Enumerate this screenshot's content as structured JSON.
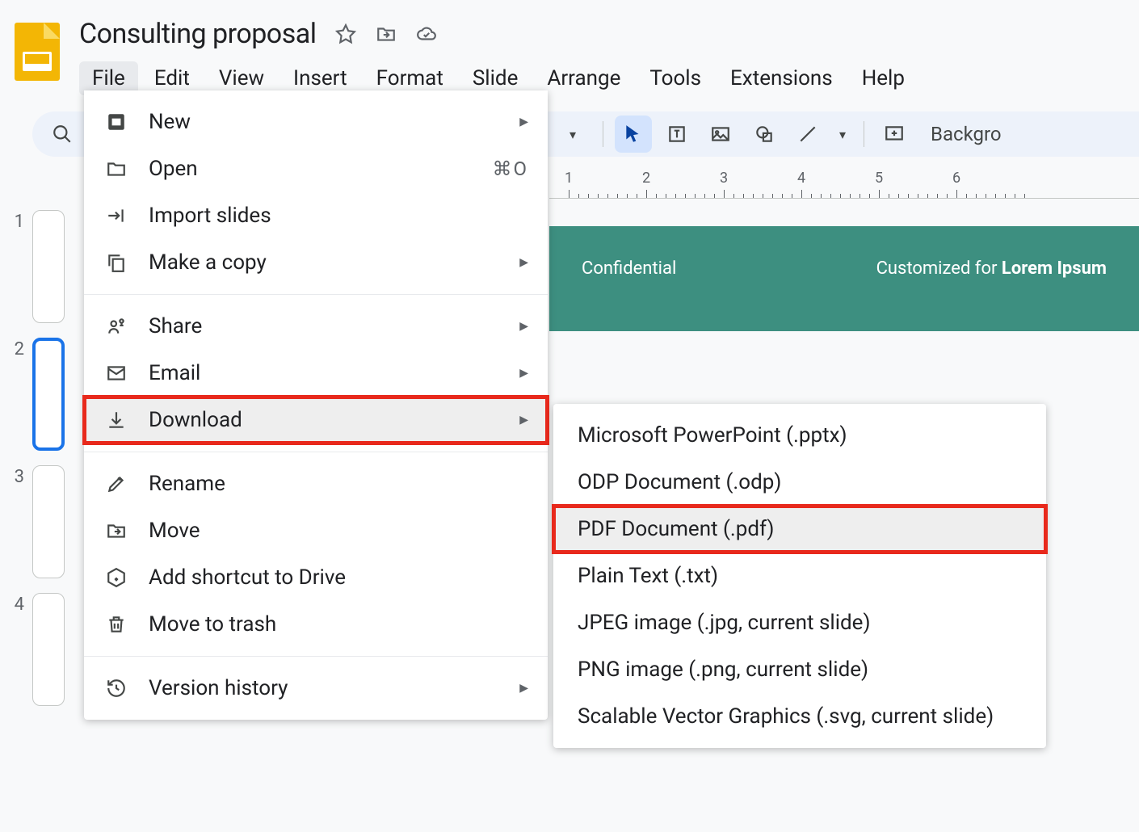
{
  "doc_title": "Consulting proposal",
  "menus": [
    "File",
    "Edit",
    "View",
    "Insert",
    "Format",
    "Slide",
    "Arrange",
    "Tools",
    "Extensions",
    "Help"
  ],
  "active_menu_index": 0,
  "toolbar_label": "Backgro",
  "ruler_numbers": [
    1,
    2,
    3,
    4,
    5,
    6
  ],
  "thumbs": [
    {
      "num": "1",
      "selected": false
    },
    {
      "num": "2",
      "selected": true
    },
    {
      "num": "3",
      "selected": false
    },
    {
      "num": "4",
      "selected": false
    }
  ],
  "canvas": {
    "left": "Confidential",
    "right_prefix": "Customized for ",
    "right_bold": "Lorem Ipsum"
  },
  "file_menu": [
    {
      "icon": "plus-box",
      "label": "New",
      "arrow": true
    },
    {
      "icon": "folder",
      "label": "Open",
      "shortcut": "⌘O"
    },
    {
      "icon": "import",
      "label": "Import slides"
    },
    {
      "icon": "copy",
      "label": "Make a copy",
      "arrow": true
    },
    {
      "sep": true
    },
    {
      "icon": "share",
      "label": "Share",
      "arrow": true
    },
    {
      "icon": "email",
      "label": "Email",
      "arrow": true
    },
    {
      "icon": "download",
      "label": "Download",
      "arrow": true,
      "highlighted": true,
      "redbox": true
    },
    {
      "sep": true
    },
    {
      "icon": "pencil",
      "label": "Rename"
    },
    {
      "icon": "move",
      "label": "Move"
    },
    {
      "icon": "shortcut",
      "label": "Add shortcut to Drive"
    },
    {
      "icon": "trash",
      "label": "Move to trash"
    },
    {
      "sep": true
    },
    {
      "icon": "history",
      "label": "Version history",
      "arrow": true
    }
  ],
  "download_submenu": [
    {
      "label": "Microsoft PowerPoint (.pptx)"
    },
    {
      "label": "ODP Document (.odp)"
    },
    {
      "label": "PDF Document (.pdf)",
      "highlighted": true,
      "redbox": true
    },
    {
      "label": "Plain Text (.txt)"
    },
    {
      "label": "JPEG image (.jpg, current slide)"
    },
    {
      "label": "PNG image (.png, current slide)"
    },
    {
      "label": "Scalable Vector Graphics (.svg, current slide)"
    }
  ]
}
